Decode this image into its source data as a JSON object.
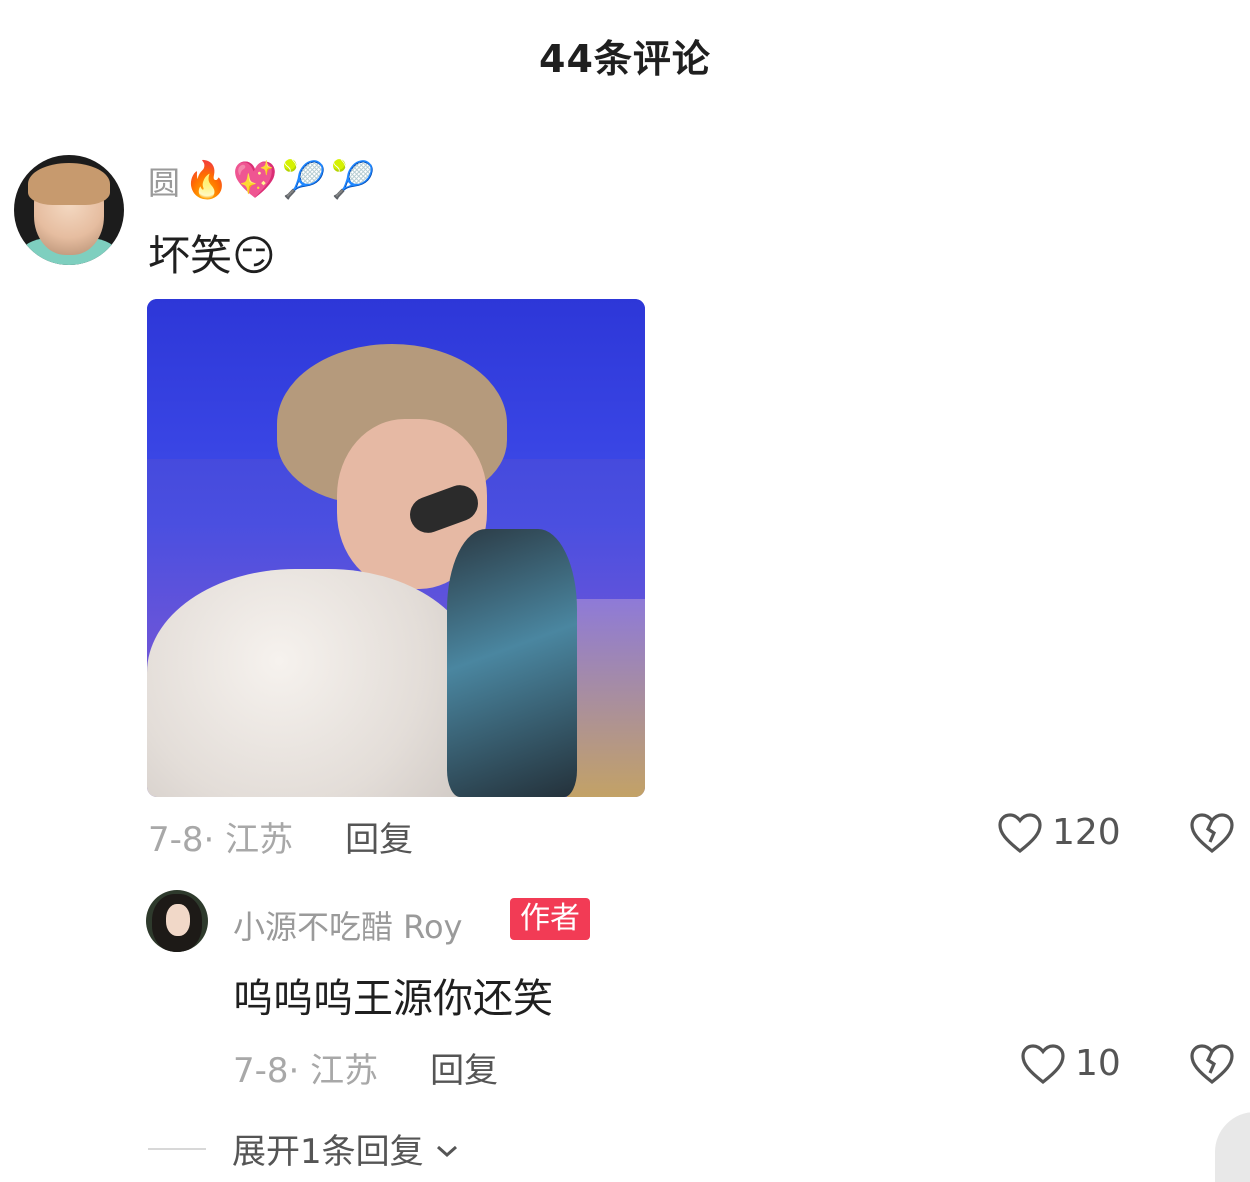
{
  "header": {
    "title": "44条评论"
  },
  "comment": {
    "username": "圆",
    "badges": [
      "🔥",
      "💖",
      "🎾",
      "🎾"
    ],
    "text": "坏笑😏",
    "date_location": "7-8· 江苏",
    "reply_label": "回复",
    "likes": "120",
    "image_alt": "meme-photo"
  },
  "reply": {
    "username": "小源不吃醋 Roy",
    "author_badge": "作者",
    "text": "呜呜呜王源你还笑",
    "date_location": "7-8· 江苏",
    "reply_label": "回复",
    "likes": "10"
  },
  "expand": {
    "label": "展开1条回复"
  },
  "colors": {
    "accent_badge": "#f23b55",
    "meta": "#a8a8a8"
  },
  "icons": [
    "heart-icon",
    "dislike-icon",
    "chevron-down-icon"
  ]
}
